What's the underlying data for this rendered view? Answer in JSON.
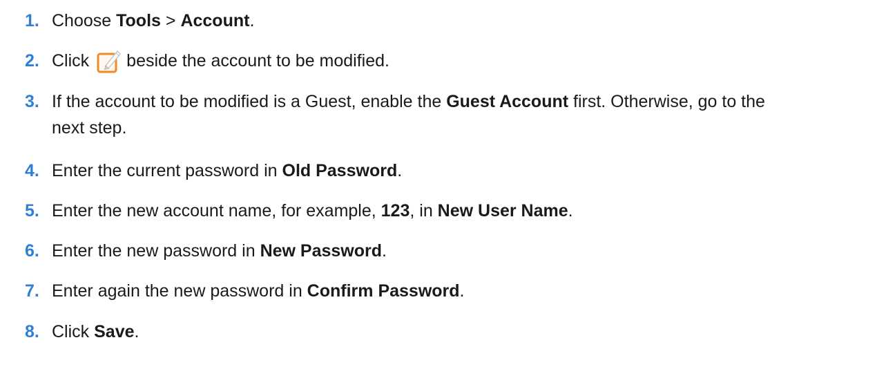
{
  "steps": [
    {
      "num": "1.",
      "parts": [
        "Choose ",
        "Tools",
        " > ",
        "Account",
        "."
      ]
    },
    {
      "num": "2.",
      "before": "Click",
      "after": "beside the account to be modified.",
      "icon": "edit-icon"
    },
    {
      "num": "3.",
      "parts": [
        "If the account to be modified is a Guest, enable the ",
        "Guest Account",
        " first. Otherwise, go to the"
      ],
      "line2": "next step."
    },
    {
      "num": "4.",
      "parts": [
        "Enter the current password in ",
        "Old Password",
        "."
      ]
    },
    {
      "num": "5.",
      "parts": [
        "Enter the new account name, for example, ",
        "123",
        ", in ",
        "New User Name",
        "."
      ]
    },
    {
      "num": "6.",
      "parts": [
        "Enter the new password in ",
        "New Password",
        "."
      ]
    },
    {
      "num": "7.",
      "parts": [
        "Enter again the new password in ",
        "Confirm Password",
        "."
      ]
    },
    {
      "num": "8.",
      "parts": [
        "Click ",
        "Save",
        "."
      ]
    }
  ],
  "colors": {
    "number": "#2f7fd6",
    "icon_accent": "#f08a24"
  }
}
